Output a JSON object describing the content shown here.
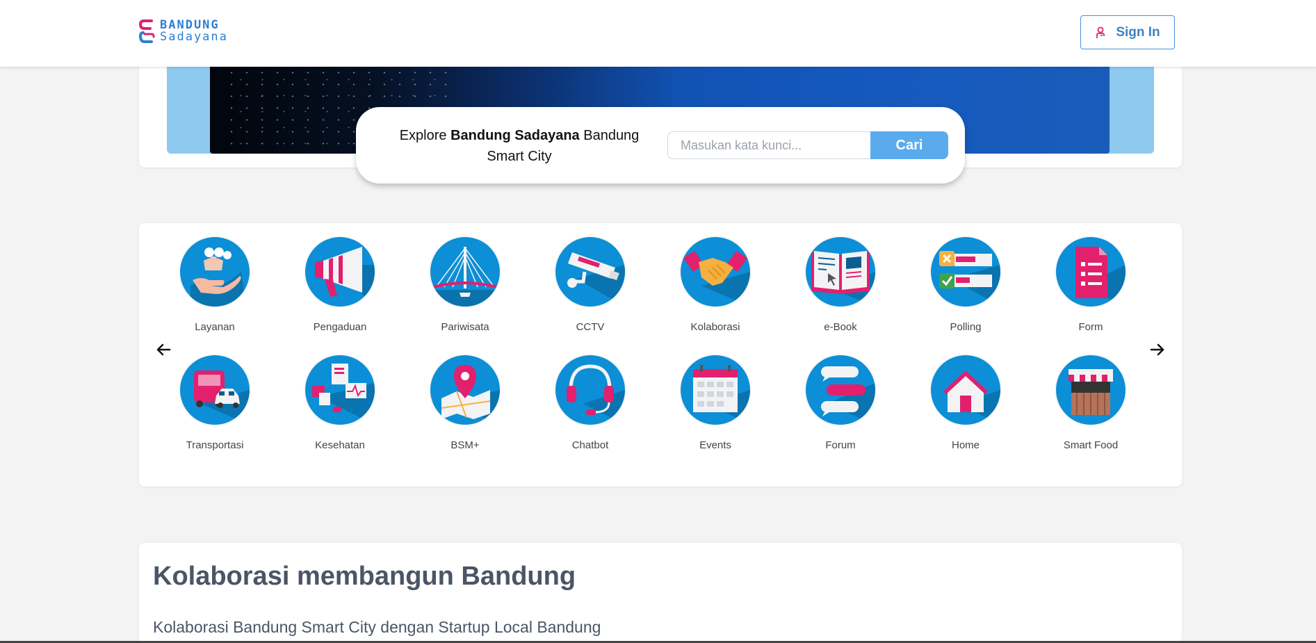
{
  "header": {
    "logo_line1": "BANDUNG",
    "logo_line2": "Sadayana",
    "signin_label": "Sign In",
    "signin_icon": "user-login-icon"
  },
  "search": {
    "intro_prefix": "Explore ",
    "intro_bold": "Bandung Sadayana",
    "intro_suffix": " Bandung Smart City",
    "placeholder": "Masukan kata kunci...",
    "button_label": "Cari"
  },
  "menu": {
    "prev_icon": "arrow-left-icon",
    "next_icon": "arrow-right-icon",
    "items": [
      {
        "label": "Layanan",
        "icon": "hand-heart-icon"
      },
      {
        "label": "Pengaduan",
        "icon": "megaphone-icon"
      },
      {
        "label": "Pariwisata",
        "icon": "bridge-icon"
      },
      {
        "label": "CCTV",
        "icon": "cctv-camera-icon"
      },
      {
        "label": "Kolaborasi",
        "icon": "handshake-icon"
      },
      {
        "label": "e-Book",
        "icon": "open-book-icon"
      },
      {
        "label": "Polling",
        "icon": "poll-checklist-icon"
      },
      {
        "label": "Form",
        "icon": "form-document-icon"
      },
      {
        "label": "Transportasi",
        "icon": "bus-car-icon"
      },
      {
        "label": "Kesehatan",
        "icon": "health-icon"
      },
      {
        "label": "BSM+",
        "icon": "map-pin-icon"
      },
      {
        "label": "Chatbot",
        "icon": "headset-icon"
      },
      {
        "label": "Events",
        "icon": "calendar-icon"
      },
      {
        "label": "Forum",
        "icon": "chat-bubbles-icon"
      },
      {
        "label": "Home",
        "icon": "house-icon"
      },
      {
        "label": "Smart Food",
        "icon": "food-stall-icon"
      }
    ]
  },
  "collab": {
    "title": "Kolaborasi membangun Bandung",
    "subtitle": "Kolaborasi Bandung Smart City dengan Startup Local Bandung"
  },
  "colors": {
    "accent": "#5aabee",
    "brand_pink": "#e2206e",
    "brand_blue": "#2d7fd3",
    "icon_circle": "#0c8fd6"
  }
}
